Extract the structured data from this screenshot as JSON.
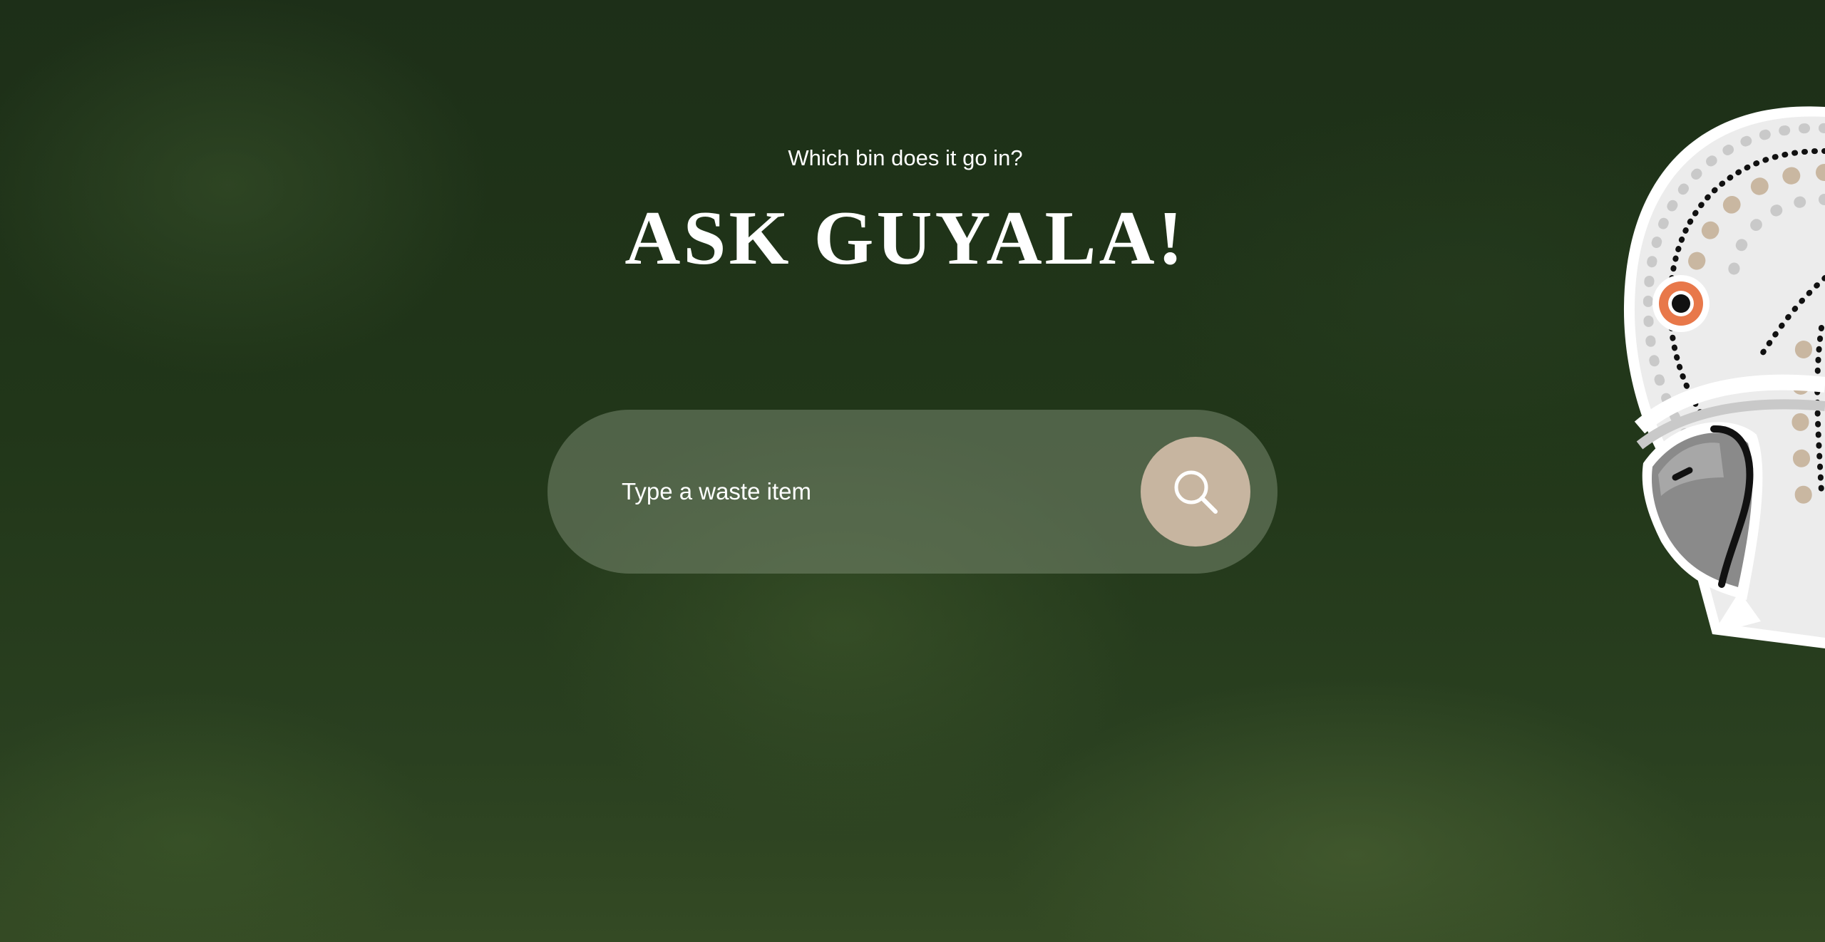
{
  "hero": {
    "eyebrow": "Which bin does it go in?",
    "title": "ASK GUYALA!"
  },
  "search": {
    "placeholder": "Type a waste item",
    "button_icon": "search-icon"
  },
  "mascot": {
    "icon": "cockatoo-mascot-icon"
  },
  "colors": {
    "background": "#213619",
    "search_bar": "#6f7f66",
    "search_button": "#c7b5a0",
    "mascot_body": "#ececec",
    "mascot_beak": "#8a8a8a",
    "mascot_eye": "#e8784a",
    "text": "#ffffff"
  }
}
